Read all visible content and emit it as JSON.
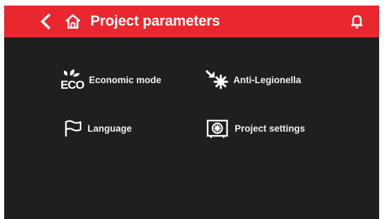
{
  "header": {
    "title": "Project parameters",
    "back_icon": "chevron-left-icon",
    "home_icon": "home-icon",
    "bell_icon": "bell-icon"
  },
  "menu": {
    "items": [
      {
        "label": "Economic mode",
        "icon": "eco-icon"
      },
      {
        "label": "Anti-Legionella",
        "icon": "anti-legionella-icon"
      },
      {
        "label": "Language",
        "icon": "flag-icon"
      },
      {
        "label": "Project settings",
        "icon": "project-settings-icon"
      }
    ]
  },
  "colors": {
    "header_bg": "#e8282e",
    "screen_bg": "#1f1f1f",
    "text": "#ffffff"
  }
}
